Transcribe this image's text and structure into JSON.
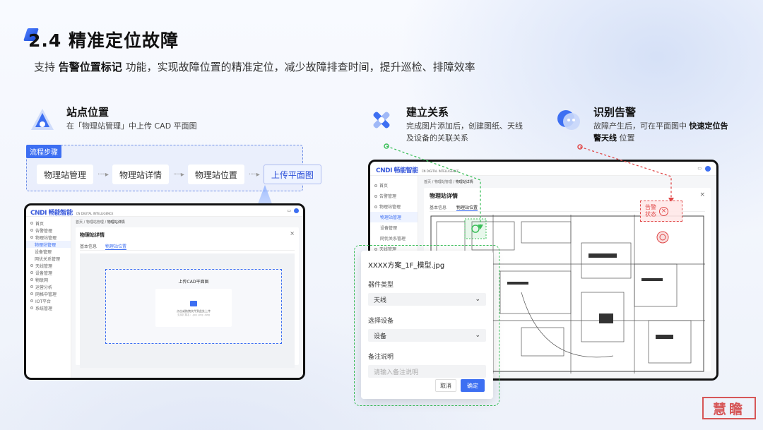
{
  "heading": {
    "title": "2.4 精准定位故障",
    "subtitle_prefix": "支持 ",
    "subtitle_bold": "告警位置标记",
    "subtitle_suffix": " 功能，实现故障位置的精准定位，减少故障排查时间，提升巡检、排障效率"
  },
  "features": [
    {
      "title": "站点位置",
      "desc": "在「物理站管理」中上传  CAD 平面图",
      "icon": "location-a-icon"
    },
    {
      "title": "建立关系",
      "desc": "完成图片添加后，创建图纸、天线及设备的关联关系",
      "icon": "wrench-link-icon"
    },
    {
      "title": "识别告警",
      "desc_prefix": "故障产生后，可在平面图中 ",
      "desc_bold": "快速定位告警天线",
      "desc_suffix": " 位置",
      "icon": "alarm-face-icon"
    }
  ],
  "flow": {
    "tag": "流程步骤",
    "steps": [
      "物理站管理",
      "物理站详情",
      "物理站位置",
      "上传平面图"
    ],
    "arrow": "·····▸"
  },
  "left_app": {
    "logo": "CNDI 畅能智能",
    "logo_sub": "CN DIGITAL INTELLIGENCE",
    "menu": [
      "首页",
      "告警管理",
      "物理站管理",
      "物理站管理",
      "设备管理",
      "网优关系管理",
      "天线管理",
      "设备管理",
      "物联网",
      "运营分析",
      "网格中管理",
      "IOT平台",
      "系统管理"
    ],
    "breadcrumb": [
      "首页",
      "物理站管理",
      "物理站详情"
    ],
    "panel_title": "物理站详情",
    "tabs": [
      "基本信息",
      "物理站位置"
    ],
    "upload_title": "上传CAD平面图",
    "upload_hint": "点击或拖拽文件到此处上传",
    "upload_sub": "支持扩展名：.jpg .png .dwg",
    "close": "×"
  },
  "right_app": {
    "logo": "CNDI 畅能智能",
    "logo_sub": "CN DIGITAL INTELLIGENCE",
    "menu": [
      "首页",
      "告警管理",
      "物理站管理",
      "物理站管理",
      "设备管理",
      "网优关系管理",
      "天线管理"
    ],
    "breadcrumb": [
      "首页",
      "物理站管理",
      "物理站详情"
    ],
    "panel_title": "物理站详情",
    "tabs": [
      "基本信息",
      "物理站位置"
    ],
    "alarm_label": "告警\n状态",
    "close": "×"
  },
  "dialog": {
    "filename": "XXXX方案_1F_模型.jpg",
    "device_type_label": "器件类型",
    "device_type_value": "天线",
    "device_label": "选择设备",
    "device_value": "设备",
    "note_label": "备注说明",
    "note_placeholder": "请输入备注说明",
    "cancel": "取消",
    "confirm": "确定"
  },
  "seal": {
    "text": "慧瞻"
  },
  "colors": {
    "accent": "#3d6ff2",
    "green": "#3bbf5a",
    "red": "#e04848"
  }
}
